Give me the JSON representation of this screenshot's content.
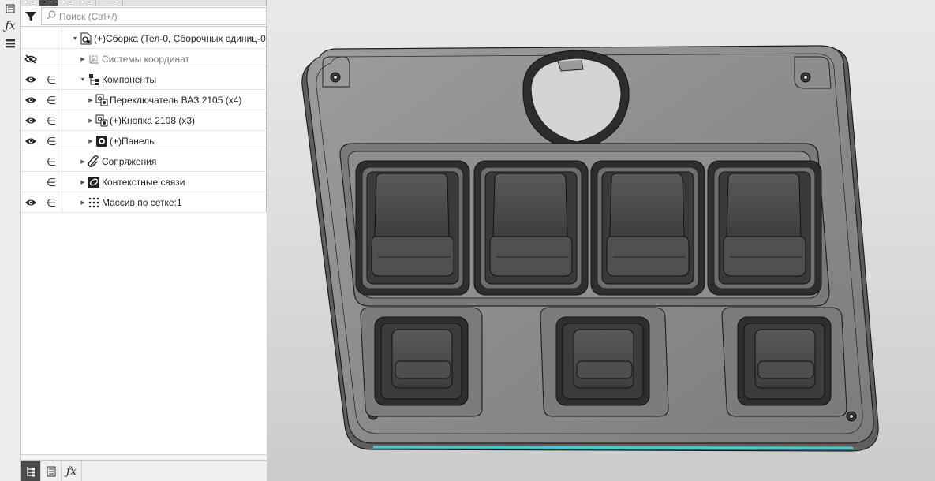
{
  "search": {
    "placeholder": "Поиск (Ctrl+/)"
  },
  "tree": {
    "root": "(+)Сборка (Тел-0, Сборочных единиц-0",
    "items": [
      {
        "label": "Системы координат",
        "visibility": "hidden-icon",
        "greyed": true
      },
      {
        "label": "Компоненты",
        "visibility": "eye-icon",
        "expanded": true
      },
      {
        "label": "Переключатель ВАЗ 2105 (x4)",
        "visibility": "eye-icon"
      },
      {
        "label": "(+)Кнопка 2108 (x3)",
        "visibility": "eye-icon"
      },
      {
        "label": "(+)Панель",
        "visibility": "eye-icon"
      },
      {
        "label": "Сопряжения",
        "visibility": ""
      },
      {
        "label": "Контекстные связи",
        "visibility": ""
      },
      {
        "label": "Массив по сетке:1",
        "visibility": "eye-icon"
      }
    ]
  },
  "icons": {
    "left_strip": [
      "tree-icon",
      "fx-icon",
      "menu-icon"
    ],
    "bottom_tabs": [
      "tree-icon",
      "properties-icon",
      "fx-icon"
    ]
  },
  "colors": {
    "accent_edge": "#39d0d6",
    "part_body": "#8a8a8a",
    "button_dark": "#4a4a4a"
  }
}
